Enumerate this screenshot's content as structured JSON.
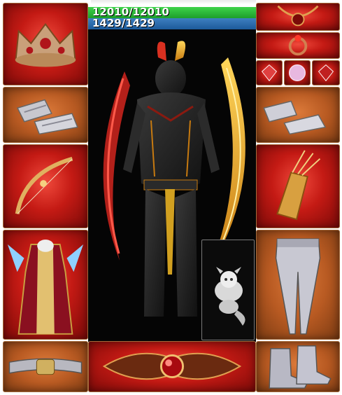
{
  "stats": {
    "hp_text": "12010/12010",
    "mp_text": "1429/1429"
  },
  "colors": {
    "slot_red": "#c41a14",
    "slot_orange": "#b85a22",
    "hp_bar": "#2fb83a",
    "mp_bar": "#2a6cb0",
    "panel_bg": "#050505"
  },
  "equipment": {
    "left": [
      {
        "slot": "helmet",
        "icon": "crown-icon",
        "bg": "red"
      },
      {
        "slot": "bracers",
        "icon": "bracers-icon",
        "bg": "orange"
      },
      {
        "slot": "weapon",
        "icon": "bow-icon",
        "bg": "red"
      },
      {
        "slot": "armor",
        "icon": "robe-armor-icon",
        "bg": "red"
      },
      {
        "slot": "belt",
        "icon": "belt-icon",
        "bg": "orange"
      }
    ],
    "right": [
      {
        "slot": "necklace",
        "icon": "necklace-icon",
        "bg": "red"
      },
      {
        "slot": "ring",
        "icon": "ring-icon",
        "bg": "red"
      },
      {
        "slot": "gloves",
        "icon": "gauntlets-icon",
        "bg": "orange"
      },
      {
        "slot": "quiver",
        "icon": "quiver-icon",
        "bg": "red"
      },
      {
        "slot": "leggings",
        "icon": "leggings-icon",
        "bg": "orange"
      },
      {
        "slot": "boots",
        "icon": "boots-icon",
        "bg": "orange"
      }
    ],
    "small": [
      {
        "slot": "charm-1",
        "icon": "gem-icon",
        "bg": "red"
      },
      {
        "slot": "charm-2",
        "icon": "orb-icon",
        "bg": "red"
      },
      {
        "slot": "charm-3",
        "icon": "gem-icon",
        "bg": "red"
      }
    ],
    "bottom_center": {
      "slot": "emblem",
      "icon": "jeweled-emblem-icon",
      "bg": "red"
    }
  },
  "character": {
    "icon": "armored-knight-icon",
    "pet_icon": "white-dragon-pet-icon"
  }
}
